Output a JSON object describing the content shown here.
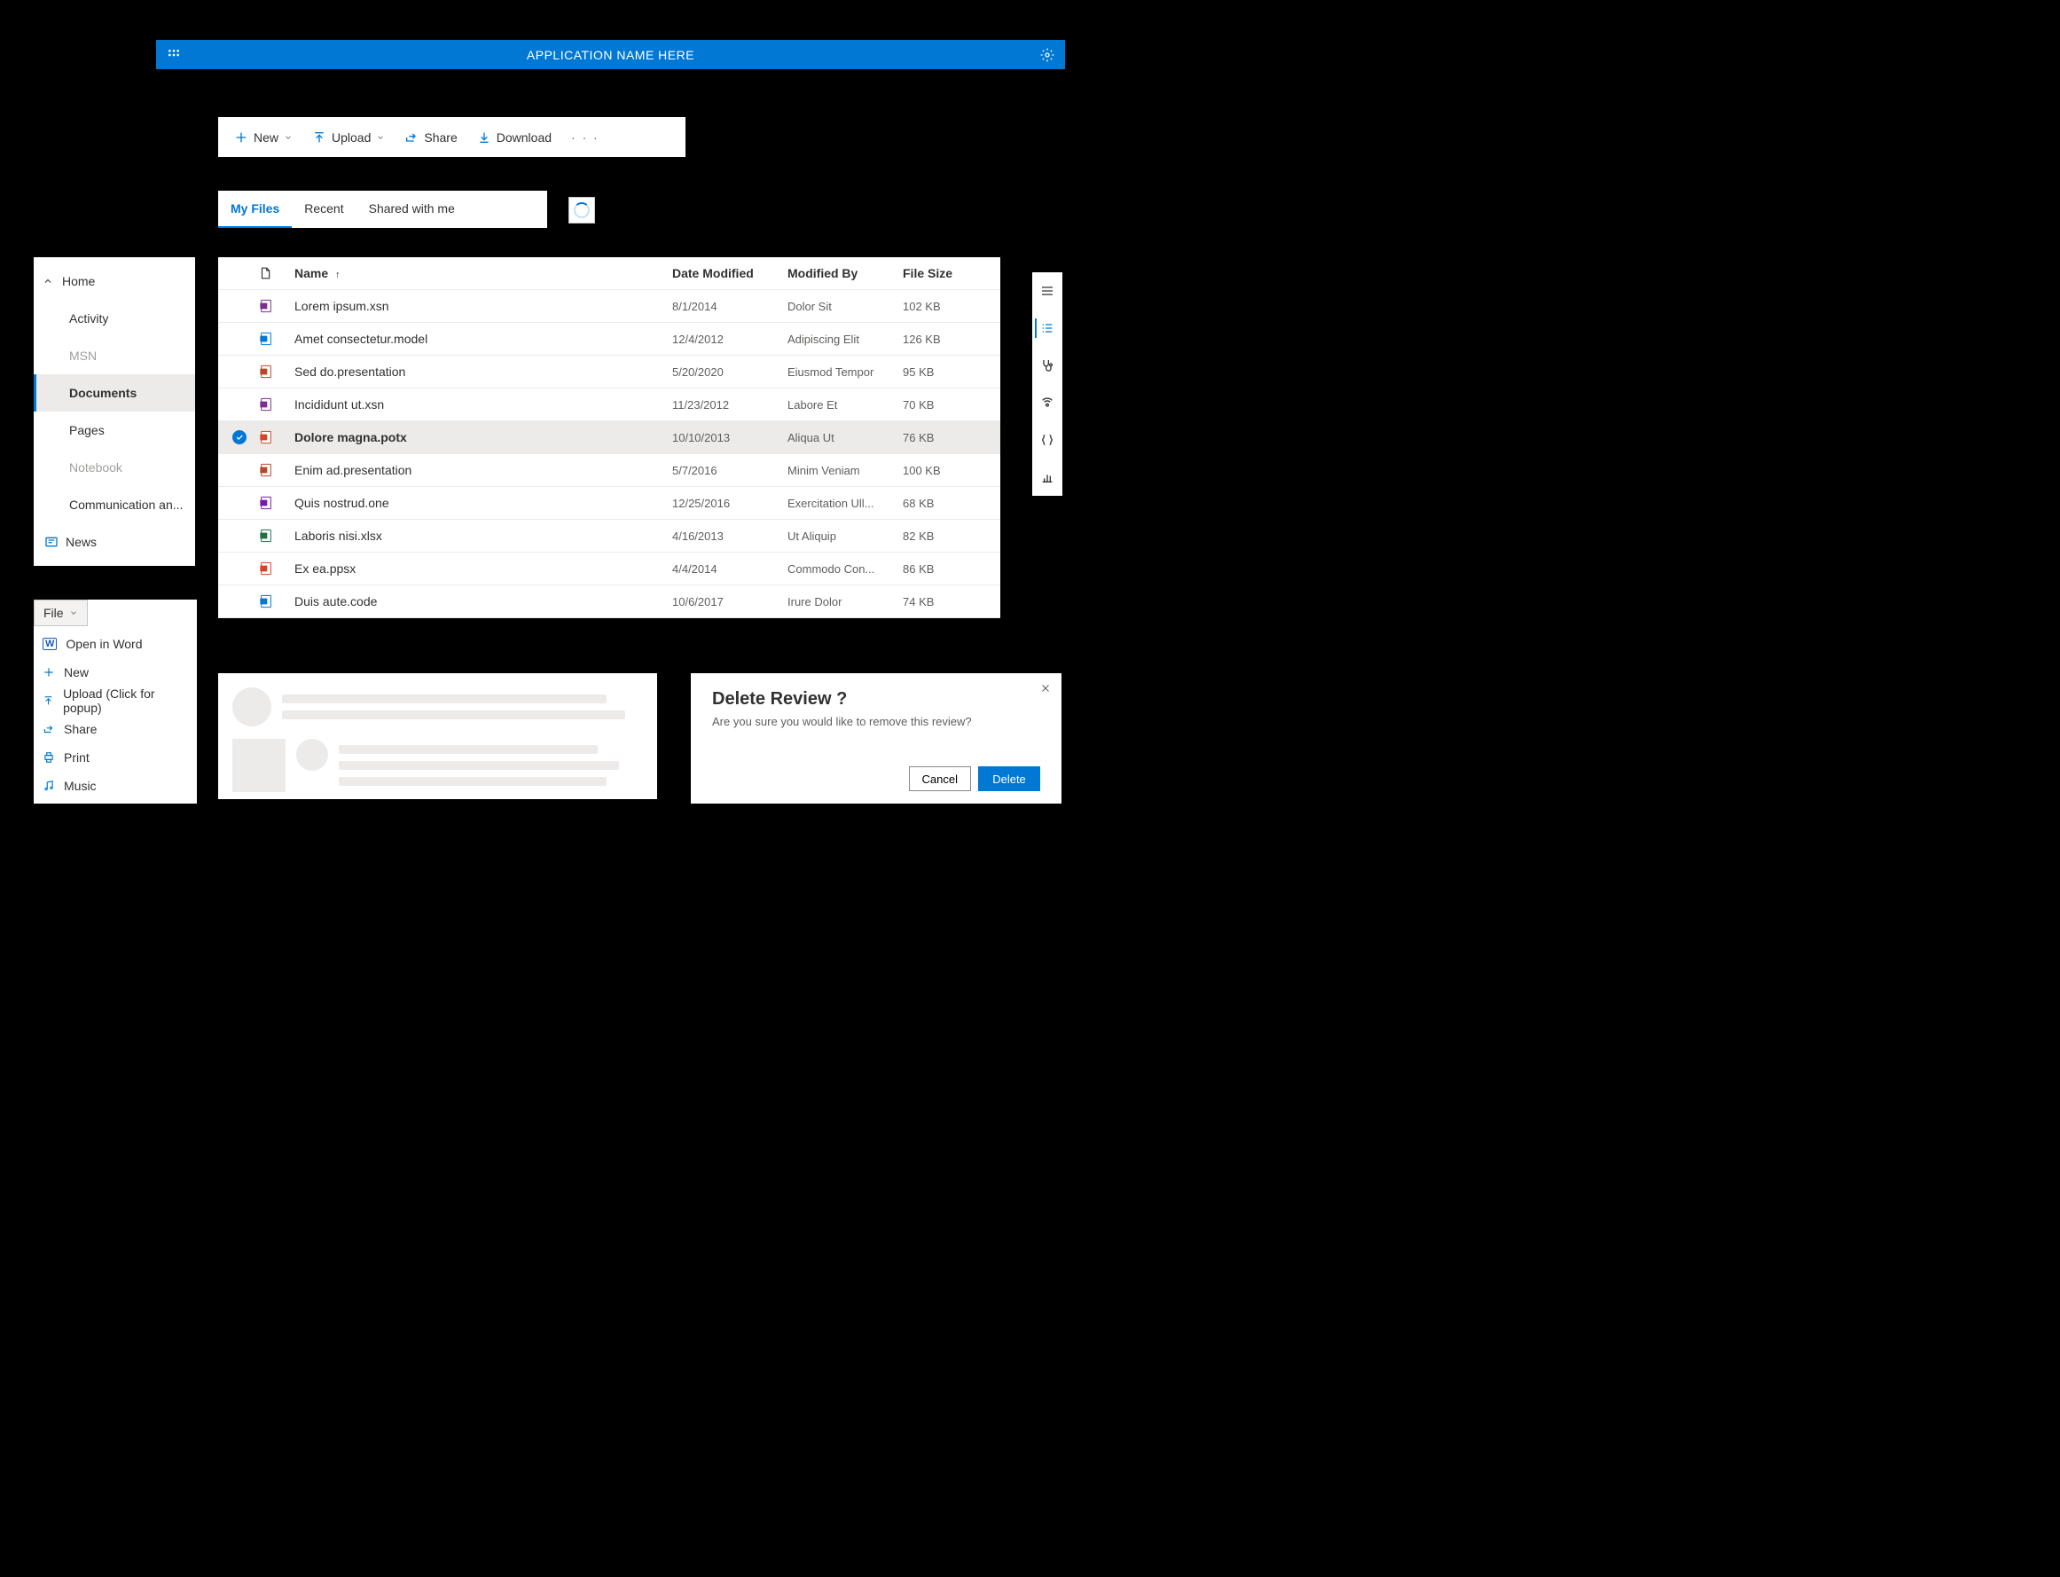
{
  "header": {
    "title": "APPLICATION NAME HERE"
  },
  "commandBar": {
    "new": "New",
    "upload": "Upload",
    "share": "Share",
    "download": "Download"
  },
  "tabs": {
    "items": [
      {
        "label": "My Files",
        "active": true
      },
      {
        "label": "Recent",
        "active": false
      },
      {
        "label": "Shared with me",
        "active": false
      }
    ]
  },
  "sidebar": {
    "home": "Home",
    "items": [
      {
        "label": "Activity"
      },
      {
        "label": "MSN",
        "disabled": true
      },
      {
        "label": "Documents",
        "selected": true
      },
      {
        "label": "Pages"
      },
      {
        "label": "Notebook",
        "disabled": true
      },
      {
        "label": "Communication an..."
      }
    ],
    "news": "News"
  },
  "fileTable": {
    "columns": {
      "name": "Name",
      "dateModified": "Date Modified",
      "modifiedBy": "Modified By",
      "fileSize": "File Size"
    },
    "sortIndicator": "↑",
    "rows": [
      {
        "icon": "infopath",
        "name": "Lorem ipsum.xsn",
        "date": "8/1/2014",
        "by": "Dolor Sit",
        "size": "102 KB"
      },
      {
        "icon": "model",
        "name": "Amet consectetur.model",
        "date": "12/4/2012",
        "by": "Adipiscing Elit",
        "size": "126 KB"
      },
      {
        "icon": "presentation",
        "name": "Sed do.presentation",
        "date": "5/20/2020",
        "by": "Eiusmod Tempor",
        "size": "95 KB"
      },
      {
        "icon": "infopath",
        "name": "Incididunt ut.xsn",
        "date": "11/23/2012",
        "by": "Labore Et",
        "size": "70 KB"
      },
      {
        "icon": "powerpoint",
        "name": "Dolore magna.potx",
        "date": "10/10/2013",
        "by": "Aliqua Ut",
        "size": "76 KB",
        "selected": true
      },
      {
        "icon": "presentation",
        "name": "Enim ad.presentation",
        "date": "5/7/2016",
        "by": "Minim Veniam",
        "size": "100 KB"
      },
      {
        "icon": "onenote",
        "name": "Quis nostrud.one",
        "date": "12/25/2016",
        "by": "Exercitation Ull...",
        "size": "68 KB"
      },
      {
        "icon": "excel",
        "name": "Laboris nisi.xlsx",
        "date": "4/16/2013",
        "by": "Ut Aliquip",
        "size": "82 KB"
      },
      {
        "icon": "ppsx",
        "name": "Ex ea.ppsx",
        "date": "4/4/2014",
        "by": "Commodo Con...",
        "size": "86 KB"
      },
      {
        "icon": "code",
        "name": "Duis aute.code",
        "date": "10/6/2017",
        "by": "Irure Dolor",
        "size": "74 KB"
      }
    ]
  },
  "fileMenu": {
    "button": "File",
    "items": [
      {
        "icon": "word",
        "label": "Open in Word"
      },
      {
        "icon": "plus",
        "label": "New"
      },
      {
        "icon": "upload",
        "label": "Upload (Click for popup)"
      },
      {
        "icon": "share",
        "label": "Share"
      },
      {
        "icon": "print",
        "label": "Print"
      },
      {
        "icon": "music",
        "label": "Music"
      }
    ]
  },
  "dialog": {
    "title": "Delete Review ?",
    "body": "Are you sure you would like to remove this review?",
    "cancel": "Cancel",
    "confirm": "Delete"
  }
}
